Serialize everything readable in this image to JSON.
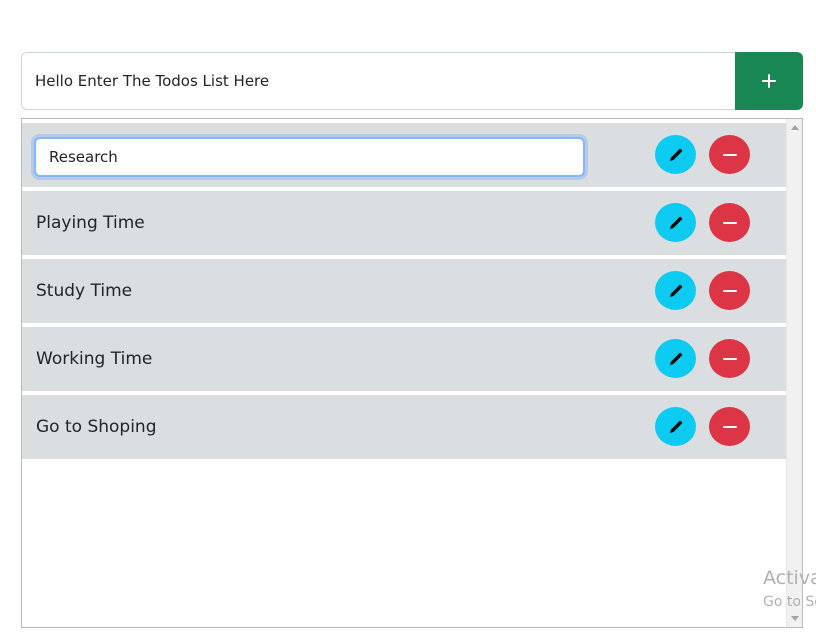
{
  "add_bar": {
    "input_value": "Hello Enter The Todos List Here",
    "add_icon": "plus-icon"
  },
  "todos": {
    "editing": {
      "value": "Research",
      "edit_icon": "pencil-icon",
      "delete_icon": "minus-icon"
    },
    "items": [
      {
        "label": "Playing Time"
      },
      {
        "label": "Study Time"
      },
      {
        "label": "Working Time"
      },
      {
        "label": "Go to Shoping"
      }
    ]
  },
  "watermark": {
    "title": "Activa",
    "subtitle": "Go to Se"
  },
  "colors": {
    "add_button": "#198754",
    "edit_button": "#0dcaf0",
    "delete_button": "#dc3545",
    "row_background": "#dadee0",
    "focus_border": "#86b7fe"
  }
}
